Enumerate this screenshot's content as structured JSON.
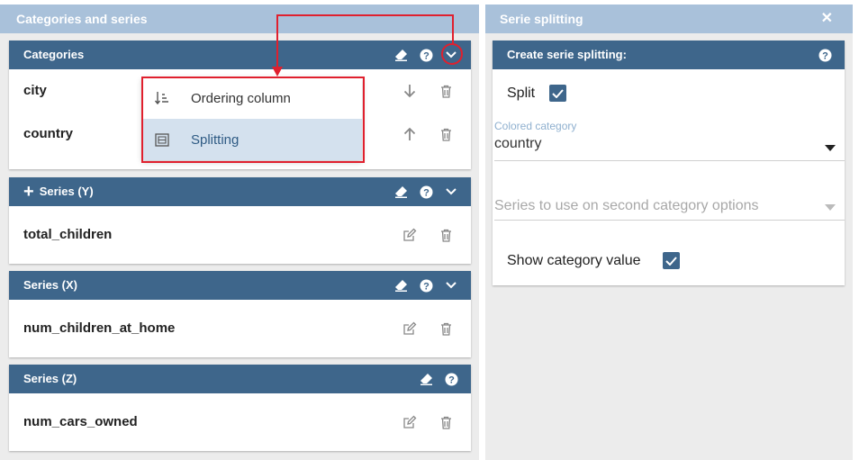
{
  "left_panel": {
    "title": "Categories and series",
    "categories": {
      "title": "Categories",
      "rows": [
        {
          "label": "city"
        },
        {
          "label": "country"
        }
      ]
    },
    "dropdown": {
      "items": [
        {
          "label": "Ordering column",
          "icon": "sort-icon",
          "active": false
        },
        {
          "label": "Splitting",
          "icon": "split-icon",
          "active": true
        }
      ]
    },
    "series_y": {
      "title": "Series (Y)",
      "rows": [
        {
          "label": "total_children"
        }
      ]
    },
    "series_x": {
      "title": "Series (X)",
      "rows": [
        {
          "label": "num_children_at_home"
        }
      ]
    },
    "series_z": {
      "title": "Series (Z)",
      "rows": [
        {
          "label": "num_cars_owned"
        }
      ]
    }
  },
  "right_panel": {
    "title": "Serie splitting",
    "card_title": "Create serie splitting:",
    "split_label": "Split",
    "split_checked": true,
    "colored_category_label": "Colored category",
    "colored_category_value": "country",
    "second_category_placeholder": "Series to use on second category options",
    "show_category_label": "Show category value",
    "show_category_checked": true
  },
  "colors": {
    "header": "#3e668b",
    "panel_title": "#a9c1da",
    "annotation": "#e0202e",
    "dropdown_active": "#d4e1ee"
  }
}
